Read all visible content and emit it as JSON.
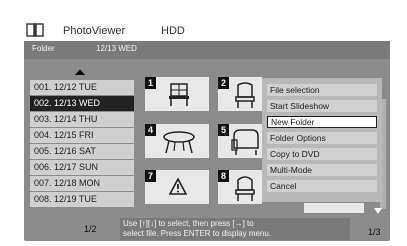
{
  "header": {
    "app_name": "PhotoViewer",
    "device": "HDD"
  },
  "panel": {
    "folder_label": "Folder",
    "current_date": "12/13 WED"
  },
  "folders": [
    "001. 12/12 TUE",
    "002. 12/13 WED",
    "003. 12/14 THU",
    "004. 12/15 FRI",
    "005. 12/16 SAT",
    "006. 12/17 SUN",
    "007. 12/18 MON",
    "008. 12/19 TUE"
  ],
  "selected_folder_index": 1,
  "folder_page": "1/2",
  "thumbnails": [
    {
      "number": "1",
      "icon": "chair-icon"
    },
    {
      "number": "2",
      "icon": "chair-icon"
    },
    {
      "number": "4",
      "icon": "table-icon"
    },
    {
      "number": "5",
      "icon": "sofa-icon"
    },
    {
      "number": "7",
      "icon": "warning-icon"
    },
    {
      "number": "8",
      "icon": "chair-icon"
    }
  ],
  "menu": {
    "items": [
      "File selection",
      "Start Slideshow",
      "New Folder",
      "Folder Options",
      "Copy to DVD",
      "Multi-Mode",
      "Cancel"
    ],
    "active_index": 2
  },
  "hint": {
    "line1": "Use [↑][↓] to select, then press [→] to",
    "line2": "select file. Press ENTER to display menu."
  },
  "thumb_page": "1/3"
}
